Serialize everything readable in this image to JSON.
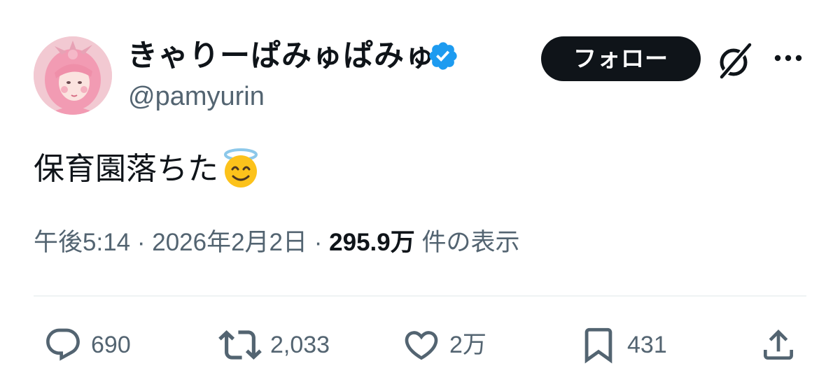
{
  "author": {
    "display_name": "きゃりーぱみゅぱみゅ",
    "handle": "@pamyurin",
    "verified": true,
    "avatar_icon": "profile-photo"
  },
  "header": {
    "follow_label": "フォロー",
    "grok_icon": "grok-icon",
    "more_icon": "more-dots-icon"
  },
  "tweet": {
    "text": "保育園落ちた",
    "emoji": "smiling-face-with-halo"
  },
  "meta": {
    "time": "午後5:14",
    "separator": " · ",
    "date": "2026年2月2日",
    "views_count": "295.9万",
    "views_label": " 件の表示"
  },
  "actions": {
    "reply_count": "690",
    "retweet_count": "2,033",
    "like_count": "2万",
    "bookmark_count": "431"
  },
  "colors": {
    "text": "#0f1419",
    "secondary": "#536471",
    "verified_blue": "#1d9bf0",
    "divider": "#eff3f4",
    "button_bg": "#0f1419"
  }
}
